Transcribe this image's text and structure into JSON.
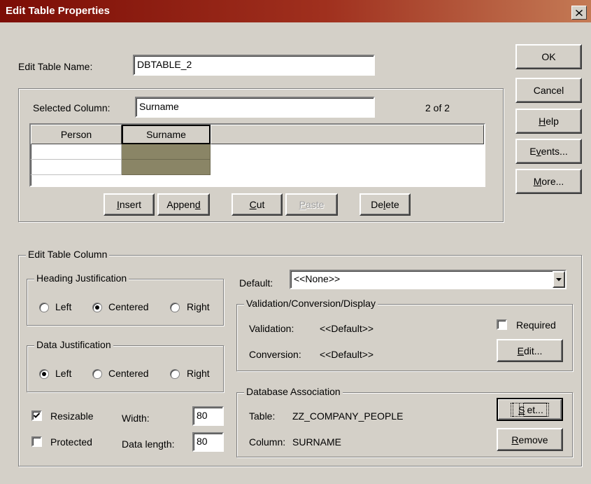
{
  "window": {
    "title": "Edit Table Properties"
  },
  "table_name": {
    "label": "Edit Table Name:",
    "value": "DBTABLE_2"
  },
  "selected_column": {
    "label": "Selected Column:",
    "value": "Surname",
    "position": "2 of 2"
  },
  "grid": {
    "columns": [
      "Person",
      "Surname"
    ]
  },
  "column_buttons": {
    "insert": {
      "pre": "",
      "key": "I",
      "post": "nsert"
    },
    "append": {
      "pre": "Appen",
      "key": "d",
      "post": ""
    },
    "cut": {
      "pre": "",
      "key": "C",
      "post": "ut"
    },
    "paste": {
      "pre": "",
      "key": "P",
      "post": "aste"
    },
    "delete": {
      "pre": "De",
      "key": "l",
      "post": "ete"
    }
  },
  "side_buttons": {
    "ok": "OK",
    "cancel": "Cancel",
    "help": {
      "pre": "",
      "key": "H",
      "post": "elp"
    },
    "events": {
      "pre": "E",
      "key": "v",
      "post": "ents..."
    },
    "more": {
      "pre": "",
      "key": "M",
      "post": "ore..."
    }
  },
  "edit_table_column": {
    "title": "Edit Table Column",
    "heading_justification": {
      "title": "Heading Justification",
      "options": [
        "Left",
        "Centered",
        "Right"
      ],
      "selected": "Centered"
    },
    "data_justification": {
      "title": "Data Justification",
      "options": [
        "Left",
        "Centered",
        "Right"
      ],
      "selected": "Left"
    },
    "resizable": {
      "label": "Resizable",
      "checked": true
    },
    "protected": {
      "label": "Protected",
      "checked": false
    },
    "width": {
      "label": "Width:",
      "value": "80"
    },
    "data_length": {
      "label": "Data length:",
      "value": "80"
    },
    "default": {
      "label": "Default:",
      "value": "<<None>>"
    },
    "validation_group": {
      "title": "Validation/Conversion/Display",
      "validation_label": "Validation:",
      "validation_value": "<<Default>>",
      "conversion_label": "Conversion:",
      "conversion_value": "<<Default>>",
      "required": {
        "label": "Required",
        "checked": false
      },
      "edit_button": {
        "pre": "",
        "key": "E",
        "post": "dit..."
      }
    },
    "database_association": {
      "title": "Database Association",
      "table_label": "Table:",
      "table_value": "ZZ_COMPANY_PEOPLE",
      "column_label": "Column:",
      "column_value": "SURNAME",
      "set_button": {
        "pre": "",
        "key": "S",
        "post": "et..."
      },
      "remove_button": {
        "pre": "",
        "key": "R",
        "post": "emove"
      }
    }
  },
  "icons": {
    "close": "close-icon",
    "dropdown": "chevron-down-icon",
    "check": "checkmark-icon"
  }
}
